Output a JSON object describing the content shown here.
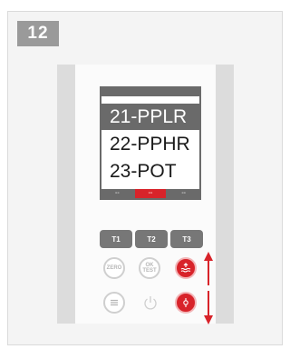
{
  "step": {
    "number": "12"
  },
  "screen": {
    "menu_items": [
      "21-PPLR",
      "22-PPHR",
      "23-POT"
    ],
    "selected_index": 0,
    "softkeys": [
      "--",
      "--",
      "--"
    ],
    "active_softkey": 1
  },
  "buttons": {
    "t1": "T1",
    "t2": "T2",
    "t3": "T3",
    "zero": "ZERO",
    "ok_test_line1": "OK",
    "ok_test_line2": "TEST"
  },
  "icons": {
    "menu": "menu-icon",
    "power": "power-icon",
    "water_heat": "water-heat-icon",
    "pump": "pump-icon",
    "arrow_up": "arrow-up-icon",
    "arrow_down": "arrow-down-icon"
  },
  "colors": {
    "accent": "#d8232a",
    "dark_grey": "#6a6a6a",
    "button_grey": "#777777"
  }
}
